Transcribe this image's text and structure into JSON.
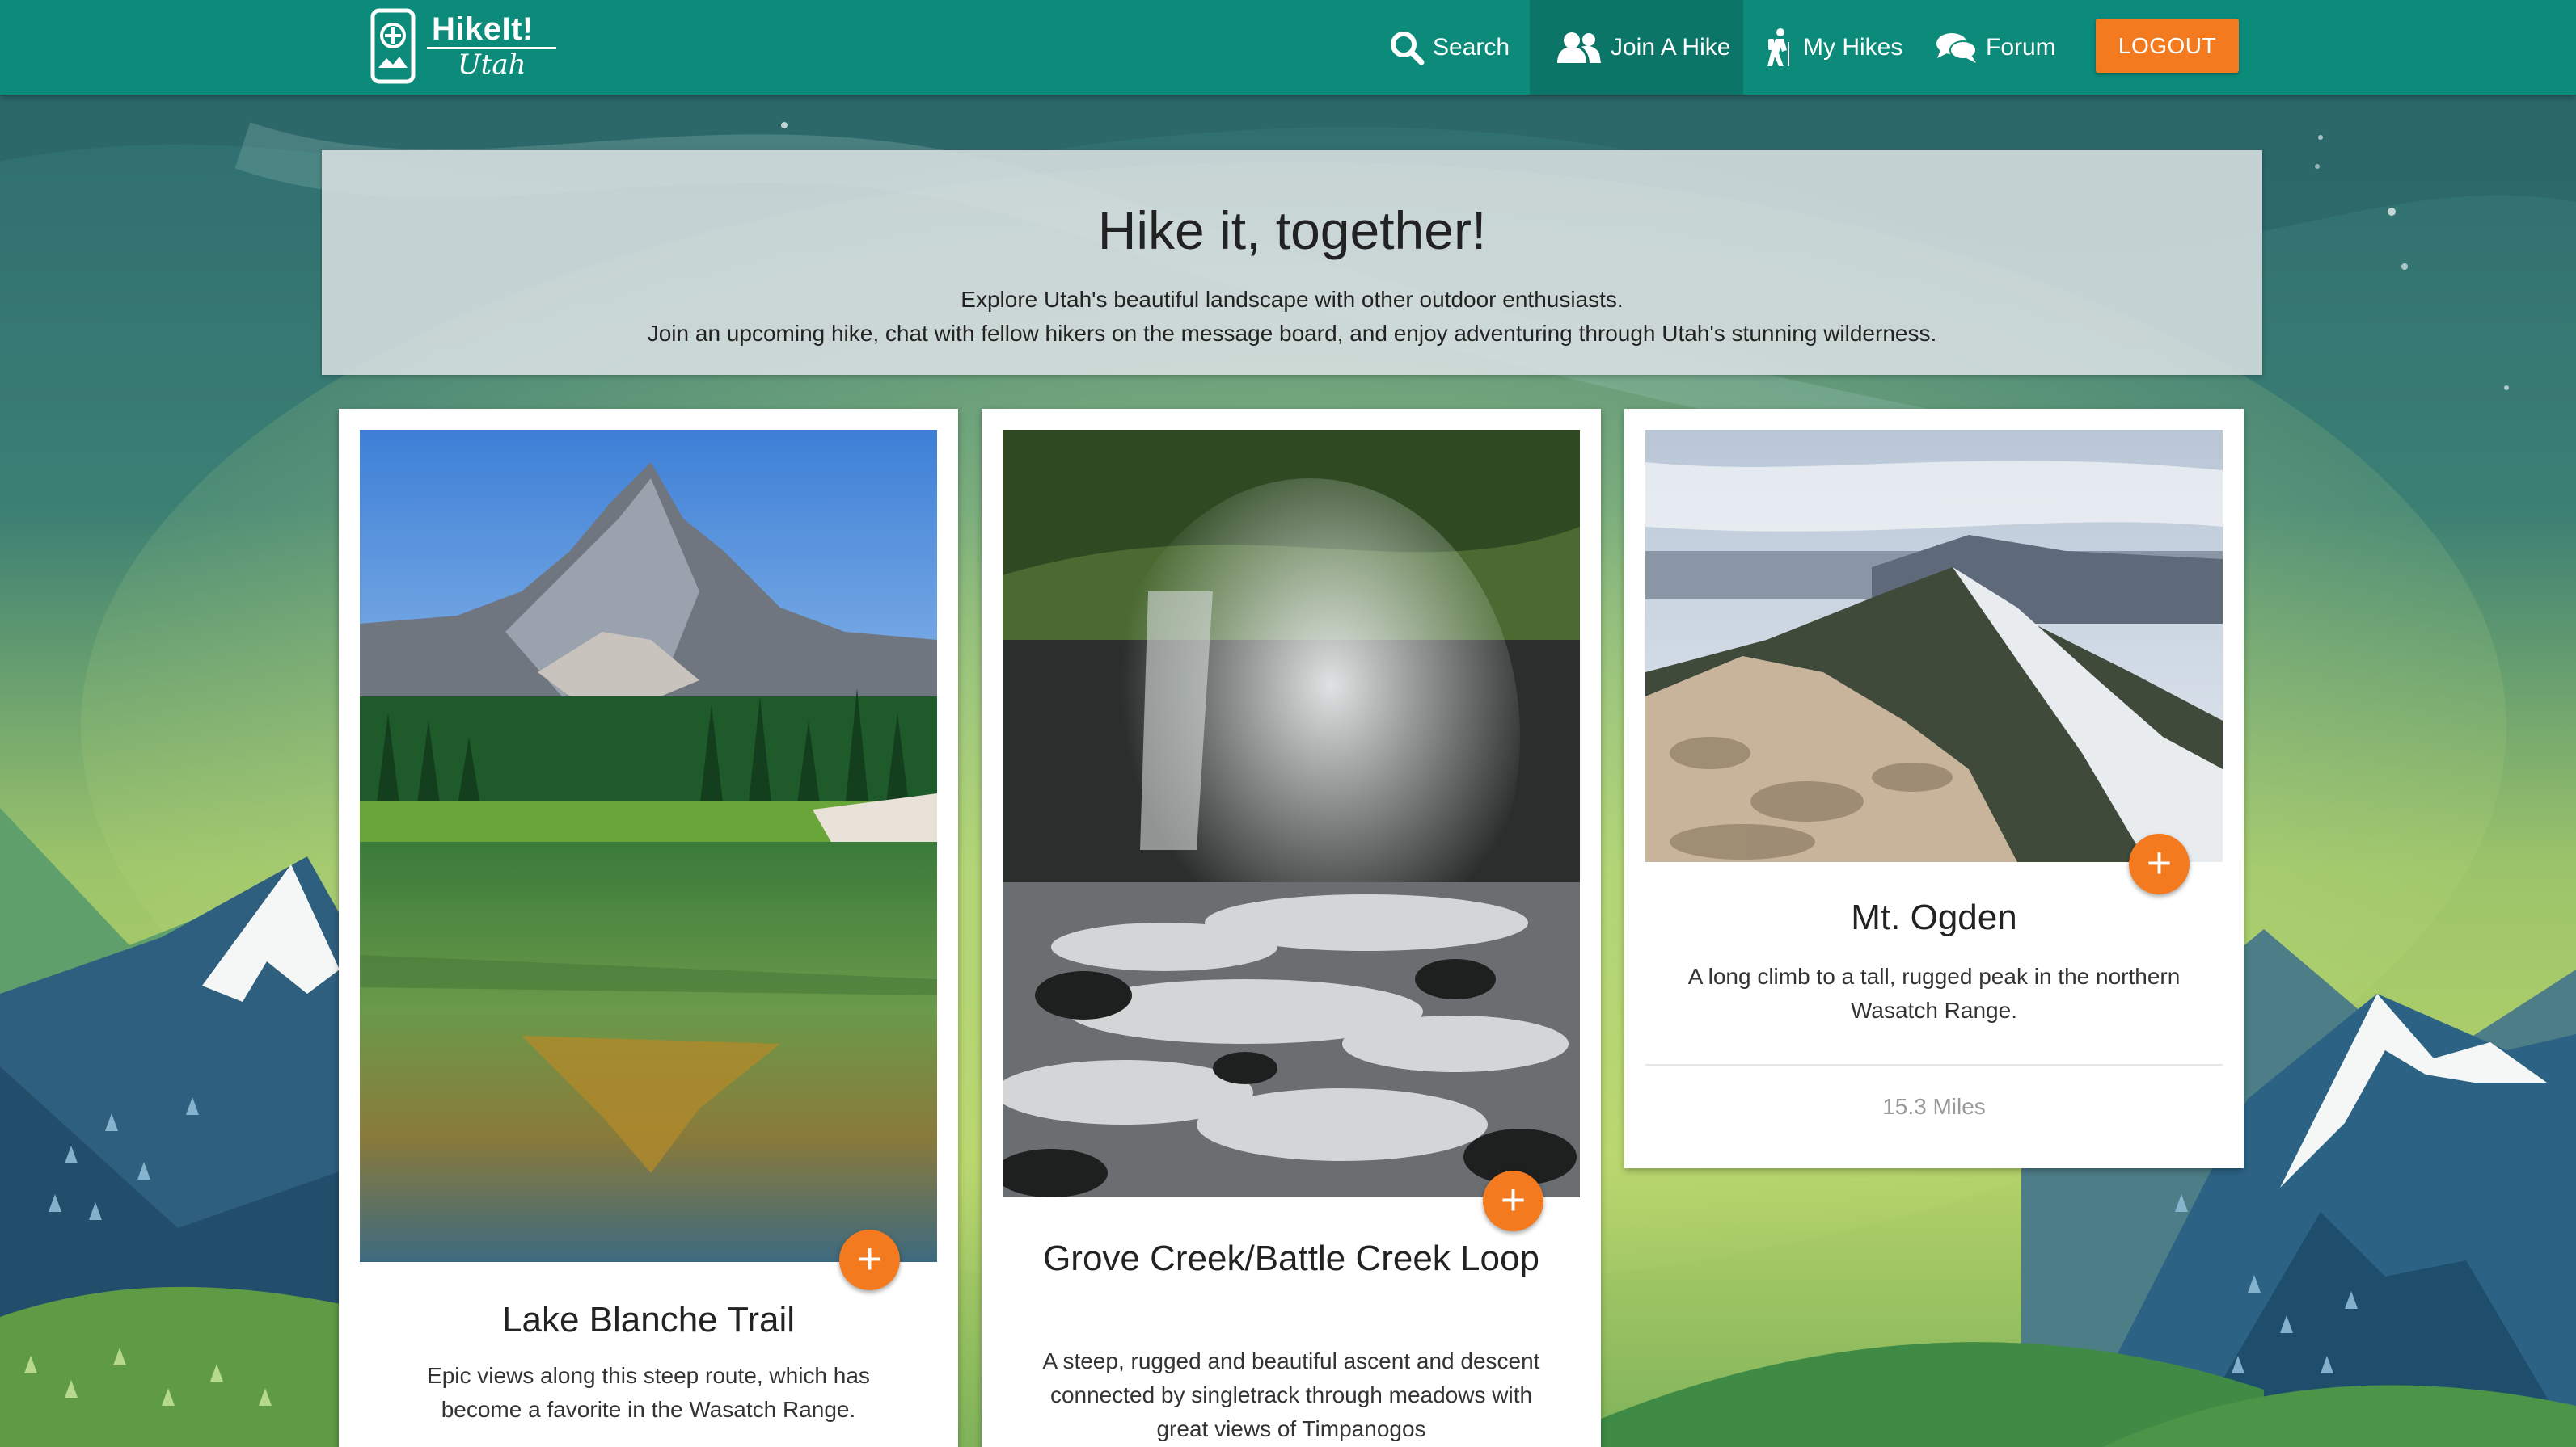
{
  "app": {
    "logo_text": "HikeIt!",
    "logo_sub": "Utah"
  },
  "nav": {
    "search": "Search",
    "join": "Join A Hike",
    "my_hikes": "My Hikes",
    "forum": "Forum",
    "logout": "LOGOUT"
  },
  "hero": {
    "title": "Hike it, together!",
    "line1": "Explore Utah's beautiful landscape with other outdoor enthusiasts.",
    "line2": "Join an upcoming hike, chat with fellow hikers on the message board, and enjoy adventuring through Utah's stunning wilderness."
  },
  "hikes": [
    {
      "name": "Lake Blanche Trail",
      "description": "Epic views along this steep route, which has become a favorite in the Wasatch Range.",
      "miles": ""
    },
    {
      "name": "Grove Creek/Battle Creek Loop",
      "description": "A steep, rugged and beautiful ascent and descent connected by singletrack through meadows with great views of Timpanogos",
      "miles": ""
    },
    {
      "name": "Mt. Ogden",
      "description": "A long climb to a tall, rugged peak in the northern Wasatch Range.",
      "miles": "15.3 Miles"
    }
  ],
  "colors": {
    "navbar": "#0d8b7a",
    "accent": "#f47a1f"
  },
  "icons": {
    "search": "search-icon",
    "join": "users-icon",
    "my_hikes": "hiker-icon",
    "forum": "comments-icon",
    "add": "plus-icon"
  }
}
